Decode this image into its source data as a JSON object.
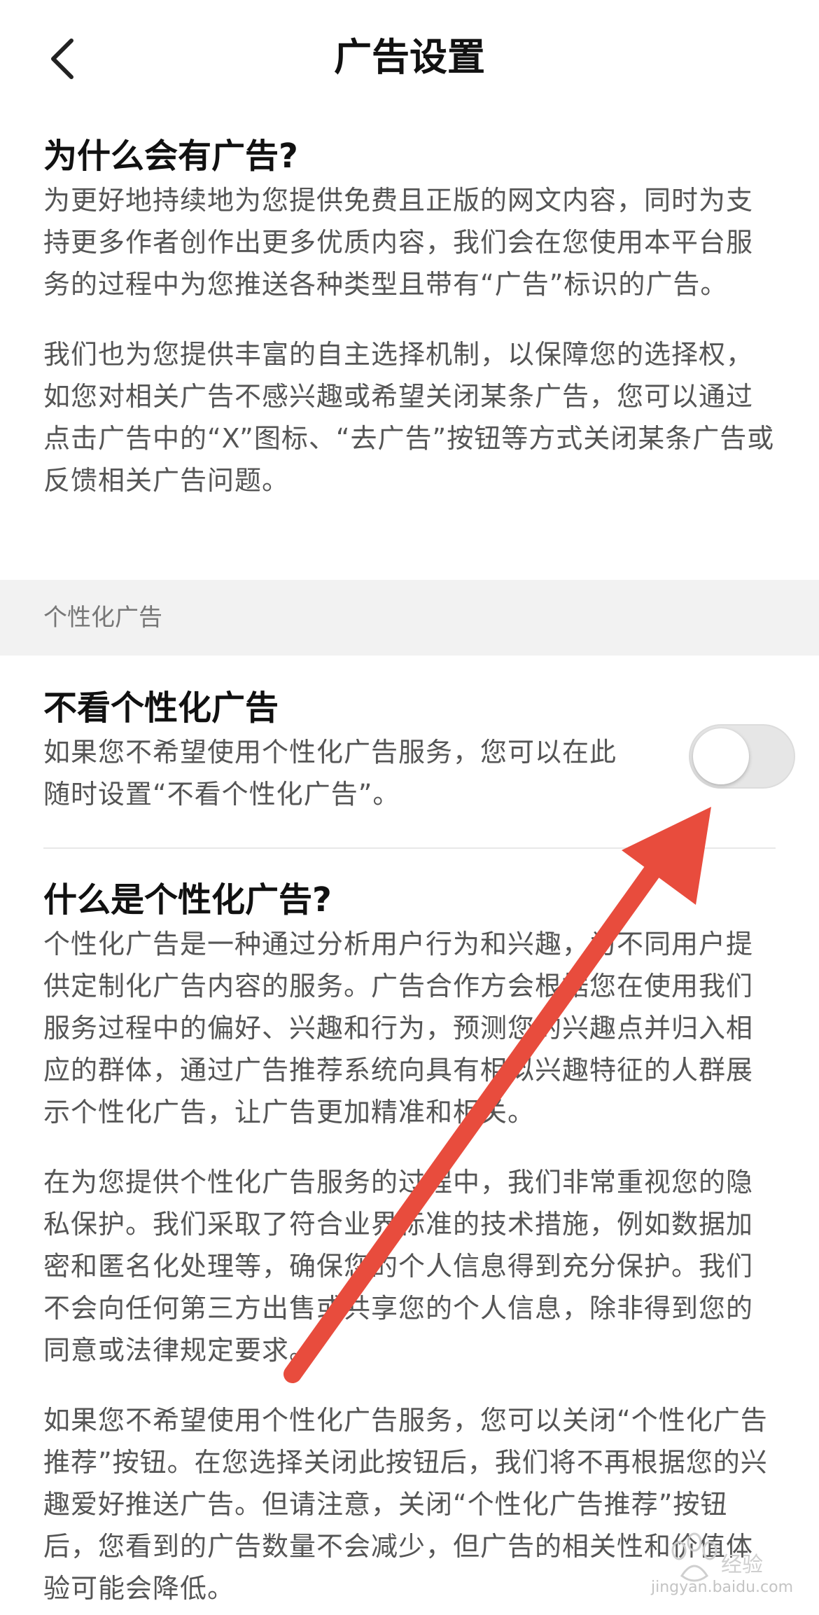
{
  "header": {
    "title": "广告设置",
    "back_icon": "chevron-left-icon"
  },
  "why_ads": {
    "title": "为什么会有广告?",
    "paragraphs": [
      "为更好地持续地为您提供免费且正版的网文内容，同时为支持更多作者创作出更多优质内容，我们会在您使用本平台服务的过程中为您推送各种类型且带有“广告”标识的广告。",
      "我们也为您提供丰富的自主选择机制，以保障您的选择权，如您对相关广告不感兴趣或希望关闭某条广告，您可以通过点击广告中的“X”图标、“去广告”按钮等方式关闭某条广告或反馈相关广告问题。"
    ]
  },
  "group_header": "个性化广告",
  "personalized_setting": {
    "title": "不看个性化广告",
    "description_line1": "如果您不希望使用个性化广告服务，您可以在此",
    "description_line2": "随时设置“不看个性化广告”。",
    "toggle_on": false
  },
  "what_is": {
    "title": "什么是个性化广告?",
    "paragraphs": [
      "个性化广告是一种通过分析用户行为和兴趣，为不同用户提供定制化广告内容的服务。广告合作方会根据您在使用我们服务过程中的偏好、兴趣和行为，预测您的兴趣点并归入相应的群体，通过广告推荐系统向具有相似兴趣特征的人群展示个性化广告，让广告更加精准和相关。",
      "在为您提供个性化广告服务的过程中，我们非常重视您的隐私保护。我们采取了符合业界标准的技术措施，例如数据加密和匿名化处理等，确保您的个人信息得到充分保护。我们不会向任何第三方出售或共享您的个人信息，除非得到您的同意或法律规定要求。",
      "如果您不希望使用个性化广告服务，您可以关闭“个性化广告推荐”按钮。在您选择关闭此按钮后，我们将不再根据您的兴趣爱好推送广告。但请注意，关闭“个性化广告推荐”按钮后，您看到的广告数量不会减少，但广告的相关性和价值体验可能会降低。"
    ]
  },
  "annotation": {
    "arrow_color": "#e84c3d"
  },
  "watermark": {
    "text": "jingyan.baidu.com",
    "logo_text": "Bai 经验"
  }
}
